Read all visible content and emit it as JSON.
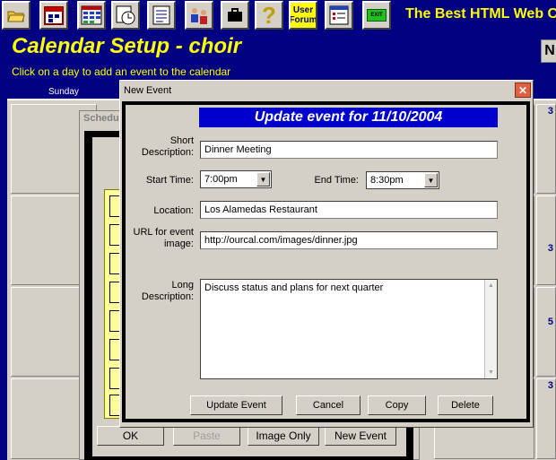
{
  "toolbar": {
    "buttons": [
      {
        "name": "open-folder-icon"
      },
      {
        "name": "calendar-icon"
      },
      {
        "name": "grid-icon"
      },
      {
        "name": "schedule-clock-icon"
      },
      {
        "name": "document-icon"
      },
      {
        "name": "users-icon"
      },
      {
        "name": "briefcase-icon"
      },
      {
        "name": "help-icon"
      },
      {
        "name": "forum-button"
      },
      {
        "name": "form-icon"
      },
      {
        "name": "exit-button"
      }
    ],
    "forum_label_line1": "User",
    "forum_label_line2": "Forum",
    "exit_label": "EXIT",
    "help_glyph": "?",
    "brand": "The Best HTML Web C"
  },
  "page": {
    "title": "Calendar Setup - choir",
    "hint": "Click on a day to add an event to the calendar",
    "right_letter": "N"
  },
  "calendar": {
    "first_day": "Sunday",
    "visible_day_numbers": [
      "3",
      "3",
      "5",
      "3"
    ]
  },
  "schedule_dialog": {
    "title": "Schedu",
    "buttons": {
      "ok": "OK",
      "paste": "Paste",
      "image_only": "Image Only",
      "new_event": "New Event"
    }
  },
  "event_dialog": {
    "title": "New Event",
    "close": "✕",
    "heading": "Update event for 11/10/2004",
    "short_desc_label": "Short\nDescription:",
    "short_desc_value": "Dinner Meeting",
    "start_time_label": "Start Time:",
    "start_time_value": "7:00pm",
    "end_time_label": "End Time:",
    "end_time_value": "8:30pm",
    "location_label": "Location:",
    "location_value": "Los Alamedas Restaurant",
    "url_label": "URL for event\nimage:",
    "url_value": "http://ourcal.com/images/dinner.jpg",
    "long_desc_label": "Long\nDescription:",
    "long_desc_value": "Discuss status and plans for next quarter",
    "buttons": {
      "update": "Update Event",
      "cancel": "Cancel",
      "copy": "Copy",
      "delete": "Delete"
    }
  },
  "colors": {
    "background": "#000080",
    "title_yellow": "#ffff00",
    "heading_blue": "#0000cc",
    "dialog_gray": "#d4d0c8"
  }
}
